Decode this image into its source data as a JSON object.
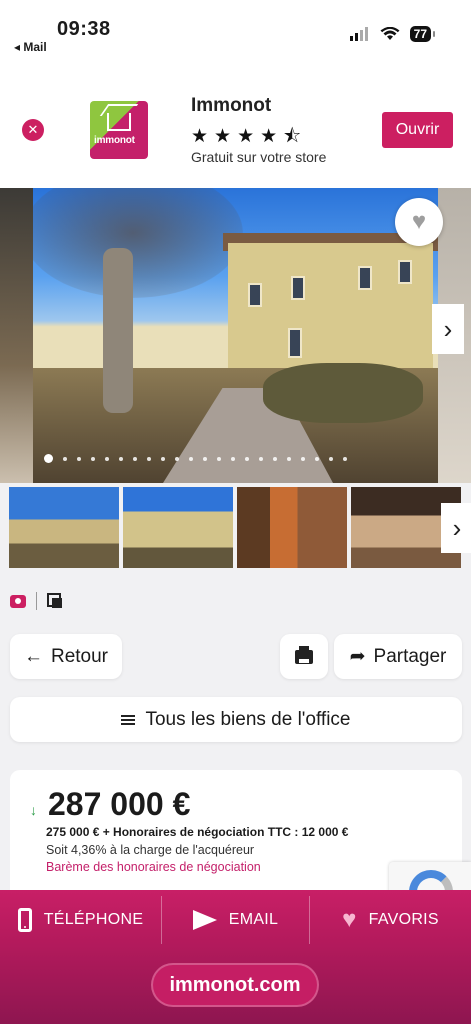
{
  "status_bar": {
    "time": "09:38",
    "back_app": "◂ Mail",
    "battery": "77"
  },
  "smart_banner": {
    "close_symbol": "✕",
    "logo_text": "immonot",
    "app_name": "Immonot",
    "stars": "★★★★⯪",
    "subtitle": "Gratuit sur votre store",
    "open_label": "Ouvrir"
  },
  "gallery": {
    "heart_symbol": "♥",
    "next_symbol": "›",
    "dot_count": 22,
    "active_dot": 0
  },
  "actions": {
    "back_label": "Retour",
    "back_symbol": "←",
    "share_label": "Partager",
    "share_symbol": "➦",
    "all_listings_label": "Tous les biens de l'office"
  },
  "price": {
    "arrow": "↓",
    "amount": "287 000 €",
    "detail": "275 000 € + Honoraires de négociation TTC : 12 000 €",
    "charge": "Soit 4,36% à la charge de l'acquéreur",
    "scale_link": "Barème des honoraires de négociation"
  },
  "bottom_bar": {
    "phone_label": "TÉLÉPHONE",
    "email_label": "EMAIL",
    "favorites_label": "FAVORIS",
    "site": "immonot.com"
  },
  "colors": {
    "brand": "#cc1f61",
    "accent_green": "#8fc63f"
  }
}
